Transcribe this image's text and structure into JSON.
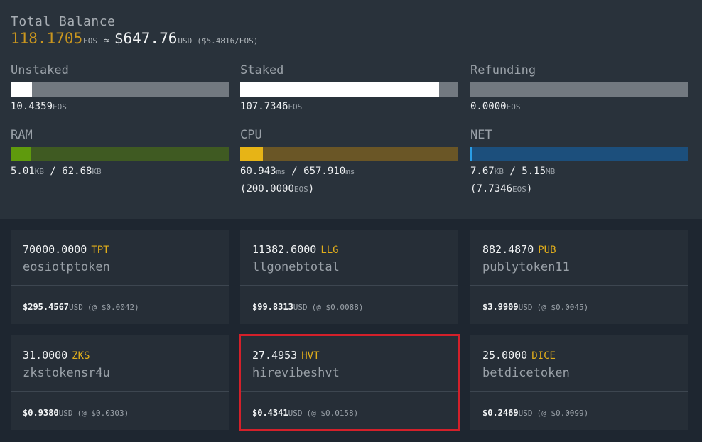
{
  "balance": {
    "title": "Total Balance",
    "eos_amount": "118.1705",
    "eos_unit": "EOS",
    "approx": "≈",
    "usd_amount": "$647.76",
    "usd_unit": "USD",
    "usd_rate": "($5.4816/EOS)"
  },
  "resources": {
    "unstaked": {
      "label": "Unstaked",
      "value": "10.4359",
      "unit": "EOS",
      "fill_fraction": 0.097,
      "fill_color": "#ffffff",
      "track_color": "#727980"
    },
    "staked": {
      "label": "Staked",
      "value": "107.7346",
      "unit": "EOS",
      "fill_fraction": 0.912,
      "fill_color": "#ffffff",
      "track_color": "#727980"
    },
    "refunding": {
      "label": "Refunding",
      "value": "0.0000",
      "unit": "EOS",
      "fill_fraction": 0.0,
      "fill_color": "#ffffff",
      "track_color": "#727980"
    },
    "ram": {
      "label": "RAM",
      "used": "5.01",
      "used_unit": "KB",
      "separator": "/",
      "total": "62.68",
      "total_unit": "KB",
      "fill_fraction": 0.092,
      "fill_color": "#5f9a0d",
      "track_color": "#3f5a22"
    },
    "cpu": {
      "label": "CPU",
      "used": "60.943",
      "used_unit": "ms",
      "separator": "/",
      "total": "657.910",
      "total_unit": "ms",
      "staked_open": "(",
      "staked": "200.0000",
      "staked_unit": "EOS",
      "staked_close": ")",
      "fill_fraction": 0.104,
      "fill_color": "#e7b416",
      "track_color": "#6a5626"
    },
    "net": {
      "label": "NET",
      "used": "7.67",
      "used_unit": "KB",
      "separator": "/",
      "total": "5.15",
      "total_unit": "MB",
      "staked_open": "(",
      "staked": "7.7346",
      "staked_unit": "EOS",
      "staked_close": ")",
      "fill_fraction": 0.01,
      "fill_color": "#2a9ee6",
      "track_color": "#1c4f7c"
    }
  },
  "tokens": [
    {
      "amount": "70000.0000",
      "symbol": "TPT",
      "contract": "eosiotptoken",
      "usd": "$295.4567",
      "usd_unit": "USD",
      "price": "(@ $0.0042)"
    },
    {
      "amount": "11382.6000",
      "symbol": "LLG",
      "contract": "llgonebtotal",
      "usd": "$99.8313",
      "usd_unit": "USD",
      "price": "(@ $0.0088)"
    },
    {
      "amount": "882.4870",
      "symbol": "PUB",
      "contract": "publytoken11",
      "usd": "$3.9909",
      "usd_unit": "USD",
      "price": "(@ $0.0045)"
    },
    {
      "amount": "31.0000",
      "symbol": "ZKS",
      "contract": "zkstokensr4u",
      "usd": "$0.9380",
      "usd_unit": "USD",
      "price": "(@ $0.0303)"
    },
    {
      "amount": "27.4953",
      "symbol": "HVT",
      "contract": "hirevibeshvt",
      "usd": "$0.4341",
      "usd_unit": "USD",
      "price": "(@ $0.0158)",
      "highlighted": true
    },
    {
      "amount": "25.0000",
      "symbol": "DICE",
      "contract": "betdicetoken",
      "usd": "$0.2469",
      "usd_unit": "USD",
      "price": "(@ $0.0099)"
    }
  ],
  "colors": {
    "background": "#1e2630",
    "panel": "#29323b",
    "card": "#262e37",
    "eos_gold": "#c9961f",
    "symbol_gold": "#e0ad1b",
    "highlight_red": "#d3202a"
  }
}
